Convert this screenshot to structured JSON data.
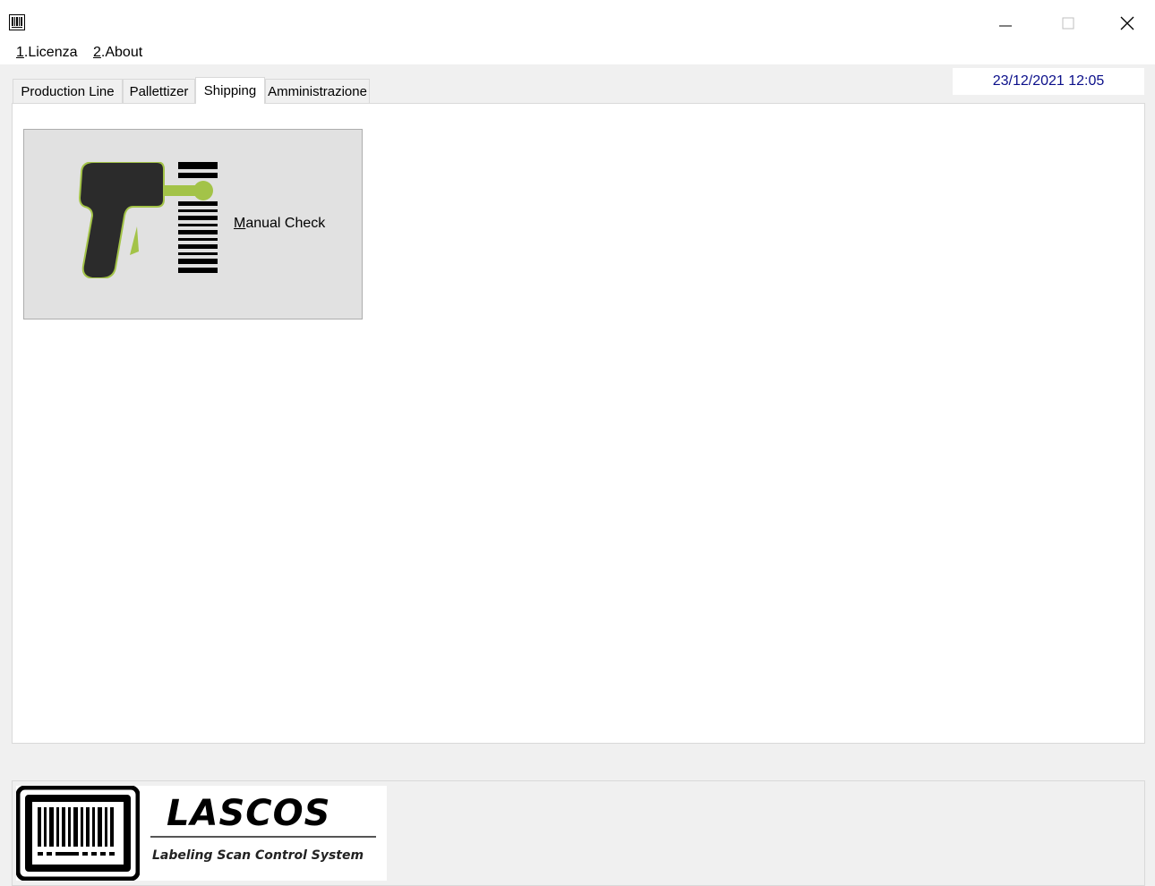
{
  "window": {
    "icon": "barcode-app-icon",
    "controls": [
      "minimize-icon",
      "maximize-icon",
      "close-icon"
    ]
  },
  "menu": [
    {
      "accel": "1",
      "rest": ".Licenza"
    },
    {
      "accel": "2",
      "rest": ".About"
    }
  ],
  "tabs": [
    "Production Line",
    "Pallettizer",
    "Shipping",
    "Amministrazione"
  ],
  "active_tab": "Shipping",
  "datetime": "23/12/2021  12:05",
  "manual_check": {
    "accel": "M",
    "rest": "anual Check",
    "icon": "barcode-scanner-icon"
  },
  "logo": {
    "title": "LASCOS",
    "subtitle": "Labeling Scan Control System",
    "icon": "barcode-logo-icon"
  },
  "colors": {
    "accent_green": "#a3c348",
    "scanner_dark": "#2b2b2b",
    "date_text": "#0b0f8a"
  }
}
